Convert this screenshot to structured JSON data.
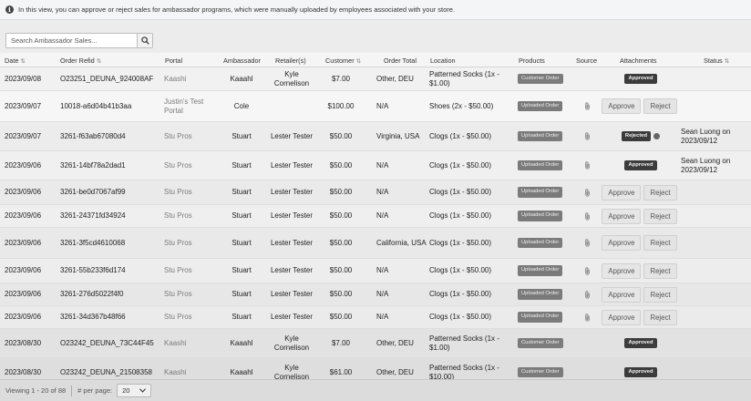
{
  "info": {
    "text": "In this view, you can approve or reject sales for ambassador programs, which were manually uploaded by employees associated with your store."
  },
  "search": {
    "placeholder": "Search Ambassador Sales..."
  },
  "columns": {
    "date": "Date",
    "order_refid": "Order Refid",
    "portal": "Portal",
    "ambassador": "Ambassador",
    "retailers": "Retailer(s)",
    "customer": "Customer",
    "order_total": "Order Total",
    "location": "Location",
    "products": "Products",
    "source": "Source",
    "attachments": "Attachments",
    "status": "Status"
  },
  "rows": [
    {
      "date": "2023/09/08",
      "refid": "O23251_DEUNA_924008AF",
      "portal": "Kaashi",
      "ambassador": "Kaaahl",
      "retailer": "Kyle Cornelison",
      "customer": "$7.00",
      "location": "Other, DEU",
      "products": "Patterned Socks (1x - $1.00)",
      "source": "Customer Order",
      "attach": "badge",
      "attach_label": "Approved",
      "status": ""
    },
    {
      "date": "2023/09/07",
      "refid": "10018-a6d04b41b3aa",
      "portal": "Justin's Test Portal",
      "ambassador": "Cole",
      "retailer": "",
      "customer": "$100.00",
      "location": "N/A",
      "products": "Shoes (2x - $50.00)",
      "source": "Uploaded Order",
      "attach": "buttons",
      "approve": "Approve",
      "reject": "Reject",
      "status": ""
    },
    {
      "date": "2023/09/07",
      "refid": "3261-f63ab67080d4",
      "portal": "Stu Pros",
      "ambassador": "Stuart",
      "retailer": "Lester Tester",
      "customer": "$50.00",
      "location": "Virginia, USA",
      "products": "Clogs (1x - $50.00)",
      "source": "Uploaded Order",
      "attach": "badge-dot",
      "attach_label": "Rejected",
      "status": "Sean Luong on 2023/09/12"
    },
    {
      "date": "2023/09/06",
      "refid": "3261-14bf78a2dad1",
      "portal": "Stu Pros",
      "ambassador": "Stuart",
      "retailer": "Lester Tester",
      "customer": "$50.00",
      "location": "N/A",
      "products": "Clogs (1x - $50.00)",
      "source": "Uploaded Order",
      "attach": "badge",
      "attach_label": "Approved",
      "status": "Sean Luong on 2023/09/12"
    },
    {
      "date": "2023/09/06",
      "refid": "3261-be0d7067af99",
      "portal": "Stu Pros",
      "ambassador": "Stuart",
      "retailer": "Lester Tester",
      "customer": "$50.00",
      "location": "N/A",
      "products": "Clogs (1x - $50.00)",
      "source": "Uploaded Order",
      "attach": "buttons",
      "approve": "Approve",
      "reject": "Reject",
      "status": ""
    },
    {
      "date": "2023/09/06",
      "refid": "3261-24371fd34924",
      "portal": "Stu Pros",
      "ambassador": "Stuart",
      "retailer": "Lester Tester",
      "customer": "$50.00",
      "location": "N/A",
      "products": "Clogs (1x - $50.00)",
      "source": "Uploaded Order",
      "attach": "buttons",
      "approve": "Approve",
      "reject": "Reject",
      "status": ""
    },
    {
      "date": "2023/09/06",
      "refid": "3261-3f5cd4610068",
      "portal": "Stu Pros",
      "ambassador": "Stuart",
      "retailer": "Lester Tester",
      "customer": "$50.00",
      "location": "California, USA",
      "products": "Clogs (1x - $50.00)",
      "source": "Uploaded Order",
      "attach": "buttons",
      "approve": "Approve",
      "reject": "Reject",
      "status": ""
    },
    {
      "date": "2023/09/06",
      "refid": "3261-55b233f6d174",
      "portal": "Stu Pros",
      "ambassador": "Stuart",
      "retailer": "Lester Tester",
      "customer": "$50.00",
      "location": "N/A",
      "products": "Clogs (1x - $50.00)",
      "source": "Uploaded Order",
      "attach": "buttons",
      "approve": "Approve",
      "reject": "Reject",
      "status": ""
    },
    {
      "date": "2023/09/06",
      "refid": "3261-276d5022f4f0",
      "portal": "Stu Pros",
      "ambassador": "Stuart",
      "retailer": "Lester Tester",
      "customer": "$50.00",
      "location": "N/A",
      "products": "Clogs (1x - $50.00)",
      "source": "Uploaded Order",
      "attach": "buttons",
      "approve": "Approve",
      "reject": "Reject",
      "status": ""
    },
    {
      "date": "2023/09/06",
      "refid": "3261-34d367b48f66",
      "portal": "Stu Pros",
      "ambassador": "Stuart",
      "retailer": "Lester Tester",
      "customer": "$50.00",
      "location": "N/A",
      "products": "Clogs (1x - $50.00)",
      "source": "Uploaded Order",
      "attach": "buttons",
      "approve": "Approve",
      "reject": "Reject",
      "status": ""
    },
    {
      "date": "2023/08/30",
      "refid": "O23242_DEUNA_73C44F45",
      "portal": "Kaashi",
      "ambassador": "Kaaahl",
      "retailer": "Kyle Cornelison",
      "customer": "$7.00",
      "location": "Other, DEU",
      "products": "Patterned Socks (1x - $1.00)",
      "source": "Customer Order",
      "attach": "badge",
      "attach_label": "Approved",
      "status": ""
    },
    {
      "date": "2023/08/30",
      "refid": "O23242_DEUNA_21508358",
      "portal": "Kaashi",
      "ambassador": "Kaaahl",
      "retailer": "Kyle Cornelison",
      "customer": "$61.00",
      "location": "Other, DEU",
      "products": "Patterned Socks (1x - $10.00)",
      "source": "Customer Order",
      "attach": "badge",
      "attach_label": "Approved",
      "status": ""
    }
  ],
  "footer": {
    "viewing": "Viewing 1 - 20 of 88",
    "per_page_label": "# per page:",
    "per_page_value": "20"
  },
  "icons": {
    "info": "info-icon",
    "search": "search-icon",
    "clip": "paperclip-icon",
    "sort": "sort-icon",
    "chevron": "chevron-down-icon"
  }
}
